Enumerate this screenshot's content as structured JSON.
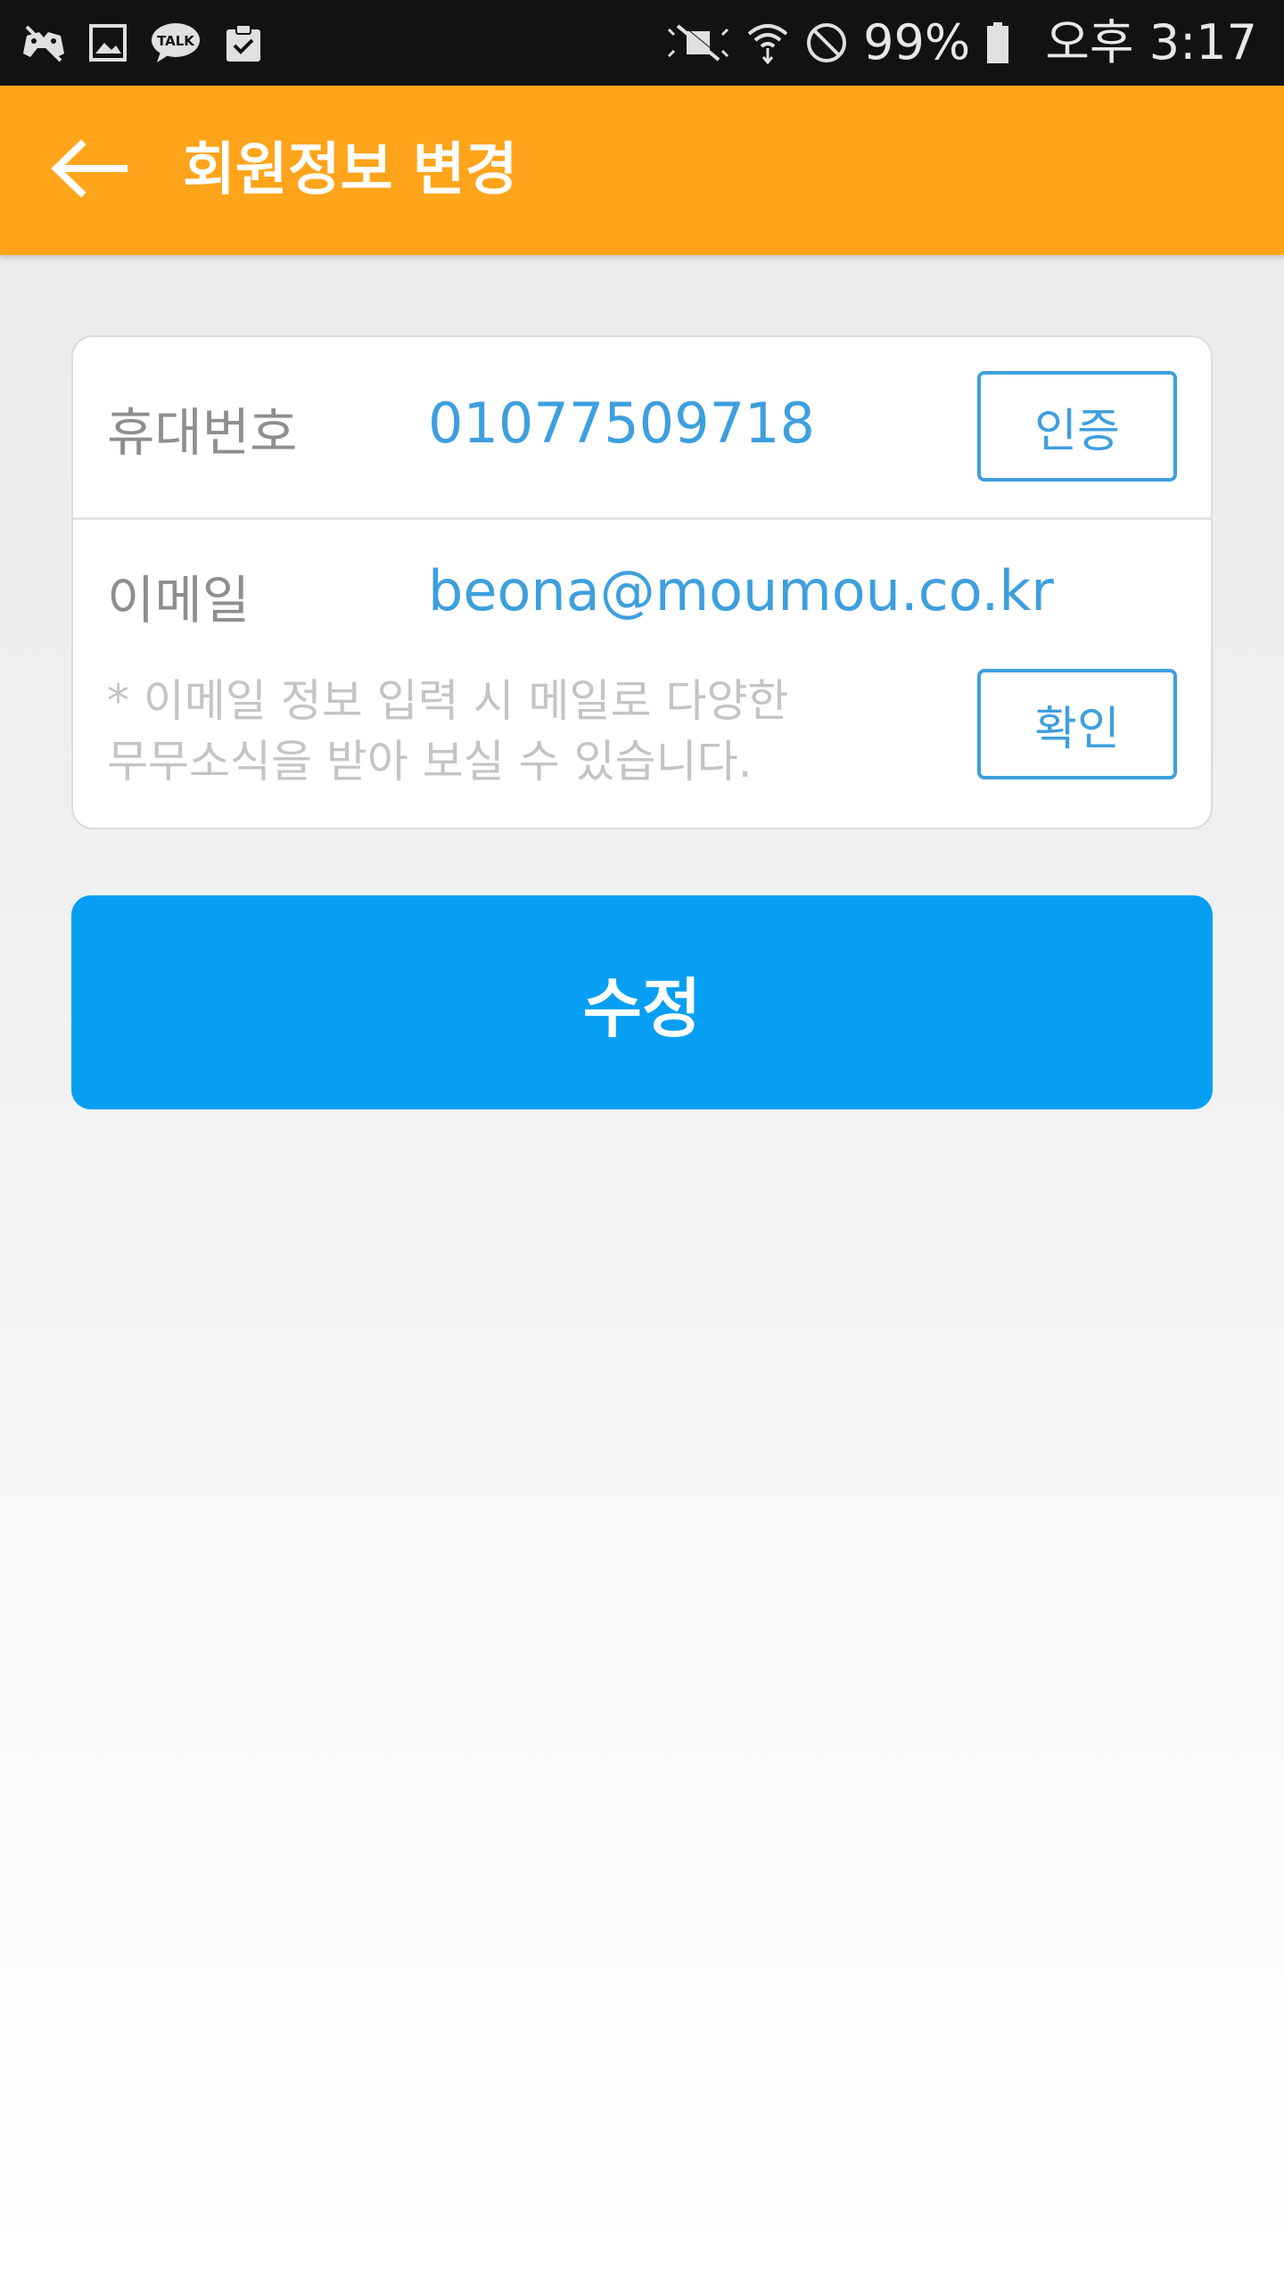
{
  "status_bar": {
    "battery": "99%",
    "time": "오후 3:17",
    "left_icons": [
      "game-controller-icon",
      "image-icon",
      "kakaotalk-icon",
      "clipboard-check-icon"
    ],
    "right_icons": [
      "mute-icon",
      "wifi-icon",
      "do-not-disturb-icon",
      "battery-icon"
    ],
    "talk_badge": "TALK"
  },
  "app_bar": {
    "title": "회원정보 변경",
    "color": "#ffa41b",
    "back_icon": "arrow-left-icon"
  },
  "form": {
    "phone": {
      "label": "휴대번호",
      "value": "01077509718",
      "button": "인증"
    },
    "email": {
      "label": "이메일",
      "value": "beona@moumou.co.kr",
      "button": "확인",
      "hint_line1": "* 이메일 정보 입력 시 메일로 다양한",
      "hint_line2": "무무소식을 받아 보실 수 있습니다."
    }
  },
  "submit": {
    "label": "수정",
    "color": "#079ff3"
  },
  "accent_color": "#3e9fde"
}
